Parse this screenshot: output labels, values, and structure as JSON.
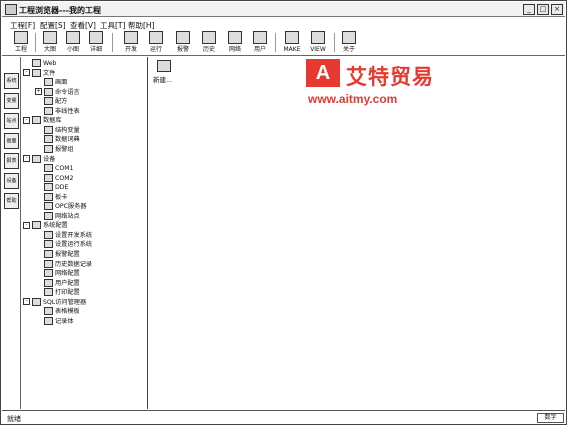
{
  "window": {
    "title": "工程浏览器---我的工程",
    "controls": [
      "_",
      "□",
      "×"
    ]
  },
  "menu": {
    "items": [
      "工程[F]",
      "配置[S]",
      "查看[V]",
      "工具[T]",
      "帮助[H]"
    ]
  },
  "toolbar": {
    "buttons": [
      {
        "label": "工程",
        "icon": "project-icon"
      },
      {
        "label": "大图",
        "icon": "large-icons-icon"
      },
      {
        "label": "小图",
        "icon": "small-icons-icon"
      },
      {
        "label": "详细",
        "icon": "details-icon"
      },
      {
        "label": "开发",
        "icon": "develop-icon"
      },
      {
        "label": "运行",
        "icon": "run-icon"
      },
      {
        "label": "报警",
        "icon": "alarm-icon"
      },
      {
        "label": "历史",
        "icon": "history-icon"
      },
      {
        "label": "网络",
        "icon": "network-icon"
      },
      {
        "label": "用户",
        "icon": "user-icon"
      },
      {
        "label": "MAKE",
        "icon": "make-icon"
      },
      {
        "label": "VIEW",
        "icon": "view-icon"
      },
      {
        "label": "关于",
        "icon": "about-icon"
      }
    ]
  },
  "side_tabs": [
    "系统",
    "变量",
    "站点",
    "画面",
    "报表",
    "设备",
    "帮助"
  ],
  "tree": {
    "nodes": [
      {
        "label": "Web",
        "level": 0,
        "expander": ""
      },
      {
        "label": "文件",
        "level": 0,
        "expander": "-"
      },
      {
        "label": "画面",
        "level": 1,
        "expander": ""
      },
      {
        "label": "命令语言",
        "level": 1,
        "expander": "+"
      },
      {
        "label": "配方",
        "level": 1,
        "expander": ""
      },
      {
        "label": "非线性表",
        "level": 1,
        "expander": ""
      },
      {
        "label": "数据库",
        "level": 0,
        "expander": "-"
      },
      {
        "label": "结构变量",
        "level": 1,
        "expander": ""
      },
      {
        "label": "数据词典",
        "level": 1,
        "expander": ""
      },
      {
        "label": "报警组",
        "level": 1,
        "expander": ""
      },
      {
        "label": "设备",
        "level": 0,
        "expander": "-"
      },
      {
        "label": "COM1",
        "level": 1,
        "expander": ""
      },
      {
        "label": "COM2",
        "level": 1,
        "expander": ""
      },
      {
        "label": "DDE",
        "level": 1,
        "expander": ""
      },
      {
        "label": "板卡",
        "level": 1,
        "expander": ""
      },
      {
        "label": "OPC服务器",
        "level": 1,
        "expander": ""
      },
      {
        "label": "网络站点",
        "level": 1,
        "expander": ""
      },
      {
        "label": "系统配置",
        "level": 0,
        "expander": "-"
      },
      {
        "label": "设置开发系统",
        "level": 1,
        "expander": ""
      },
      {
        "label": "设置运行系统",
        "level": 1,
        "expander": ""
      },
      {
        "label": "报警配置",
        "level": 1,
        "expander": ""
      },
      {
        "label": "历史数据记录",
        "level": 1,
        "expander": ""
      },
      {
        "label": "网络配置",
        "level": 1,
        "expander": ""
      },
      {
        "label": "用户配置",
        "level": 1,
        "expander": ""
      },
      {
        "label": "打印配置",
        "level": 1,
        "expander": ""
      },
      {
        "label": "SQL访问管理器",
        "level": 0,
        "expander": "-"
      },
      {
        "label": "表格模板",
        "level": 1,
        "expander": ""
      },
      {
        "label": "记录体",
        "level": 1,
        "expander": ""
      }
    ]
  },
  "content": {
    "new_item_label": "新建..."
  },
  "status": {
    "text": "就绪",
    "right_pane": "数字"
  },
  "watermark": {
    "logo": "A",
    "name": "艾特贸易",
    "url": "www.aitmy.com"
  },
  "colors": {
    "watermark": "#e63a31",
    "border": "#444444"
  }
}
